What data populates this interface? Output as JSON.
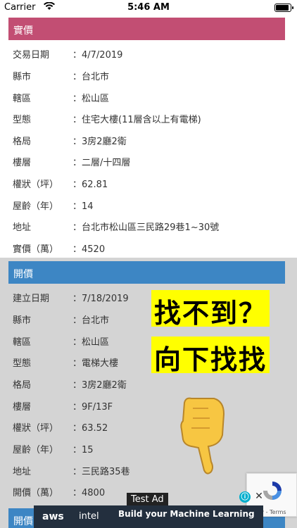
{
  "status": {
    "carrier": "Carrier",
    "wifi_icon": "wifi-icon",
    "time": "5:46 AM"
  },
  "deal": {
    "header": "實價",
    "rows": [
      {
        "label": "交易日期",
        "value": "：4/7/2019"
      },
      {
        "label": "縣市",
        "value": "：台北市"
      },
      {
        "label": "轄區",
        "value": "：松山區"
      },
      {
        "label": "型態",
        "value": "：住宅大樓(11層含以上有電梯)"
      },
      {
        "label": "格局",
        "value": "：3房2廳2衛"
      },
      {
        "label": "樓層",
        "value": "：二層/十四層"
      },
      {
        "label": "權狀（坪）",
        "value": "：62.81"
      },
      {
        "label": "屋齡（年）",
        "value": "：14"
      },
      {
        "label": "地址",
        "value": "：台北市松山區三民路29巷1~30號"
      },
      {
        "label": "實價（萬）",
        "value": "：4520"
      }
    ]
  },
  "listing": {
    "header": "開價",
    "rows": [
      {
        "label": "建立日期",
        "value": "：7/18/2019"
      },
      {
        "label": "縣市",
        "value": "：台北市"
      },
      {
        "label": "轄區",
        "value": "：松山區"
      },
      {
        "label": "型態",
        "value": "：電梯大樓"
      },
      {
        "label": "格局",
        "value": "：3房2廳2衛"
      },
      {
        "label": "樓層",
        "value": "：9F/13F"
      },
      {
        "label": "權狀（坪）",
        "value": "：63.52"
      },
      {
        "label": "屋齡（年）",
        "value": "：15"
      },
      {
        "label": "地址",
        "value": "：三民路35巷"
      },
      {
        "label": "開價（萬）",
        "value": "：4800"
      }
    ]
  },
  "next": {
    "header": "開價"
  },
  "overlay": {
    "line1": "找不到？",
    "line2": "向下找找"
  },
  "ad": {
    "label": "Test Ad",
    "brand1": "aws",
    "brand2": "intel",
    "message": "Build your Machine Learning",
    "info_icon": "ⓘ",
    "close_icon": "✕"
  },
  "recaptcha": {
    "text": "acy - Terms"
  }
}
